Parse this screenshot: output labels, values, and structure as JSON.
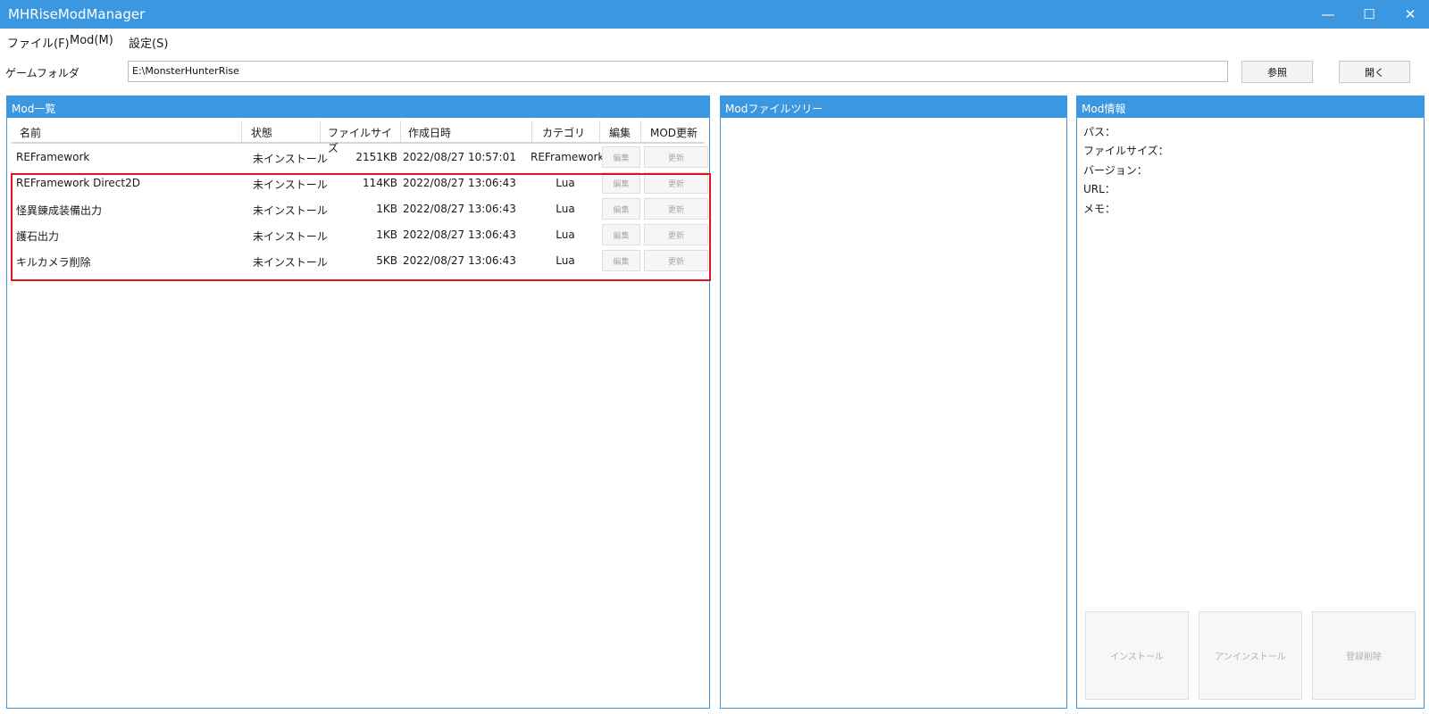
{
  "window": {
    "title": "MHRiseModManager",
    "minimize_glyph": "—",
    "maximize_glyph": "☐",
    "close_glyph": "✕"
  },
  "menu": {
    "items": [
      {
        "label": "ファイル(F)"
      },
      {
        "label": "Mod(M)"
      },
      {
        "label": "設定(S)"
      }
    ]
  },
  "game_folder": {
    "label": "ゲームフォルダ",
    "value": "E:\\MonsterHunterRise",
    "browse_label": "参照",
    "open_label": "開く"
  },
  "mod_list": {
    "title": "Mod一覧",
    "columns": [
      "名前",
      "状態",
      "ファイルサイズ",
      "作成日時",
      "カテゴリ",
      "編集",
      "MOD更新"
    ],
    "edit_button": "編集",
    "update_button": "更新",
    "rows": [
      {
        "name": "REFramework",
        "status": "未インストール",
        "size": "2151KB",
        "created": "2022/08/27 10:57:01",
        "category": "REFramework"
      },
      {
        "name": "REFramework Direct2D",
        "status": "未インストール",
        "size": "114KB",
        "created": "2022/08/27 13:06:43",
        "category": "Lua"
      },
      {
        "name": "怪異錬成装備出力",
        "status": "未インストール",
        "size": "1KB",
        "created": "2022/08/27 13:06:43",
        "category": "Lua"
      },
      {
        "name": "護石出力",
        "status": "未インストール",
        "size": "1KB",
        "created": "2022/08/27 13:06:43",
        "category": "Lua"
      },
      {
        "name": "キルカメラ削除",
        "status": "未インストール",
        "size": "5KB",
        "created": "2022/08/27 13:06:43",
        "category": "Lua"
      }
    ],
    "highlight_color": "#e0141e"
  },
  "file_tree": {
    "title": "Modファイルツリー"
  },
  "mod_info": {
    "title": "Mod情報",
    "path_label": "パス：",
    "size_label": "ファイルサイズ：",
    "version_label": "バージョン：",
    "url_label": "URL：",
    "memo_label": "メモ：",
    "install_label": "インストール",
    "uninstall_label": "アンインストール",
    "unregister_label": "登録削除"
  },
  "colors": {
    "accent": "#3b97df",
    "disabled_text": "#a8a8a8"
  }
}
